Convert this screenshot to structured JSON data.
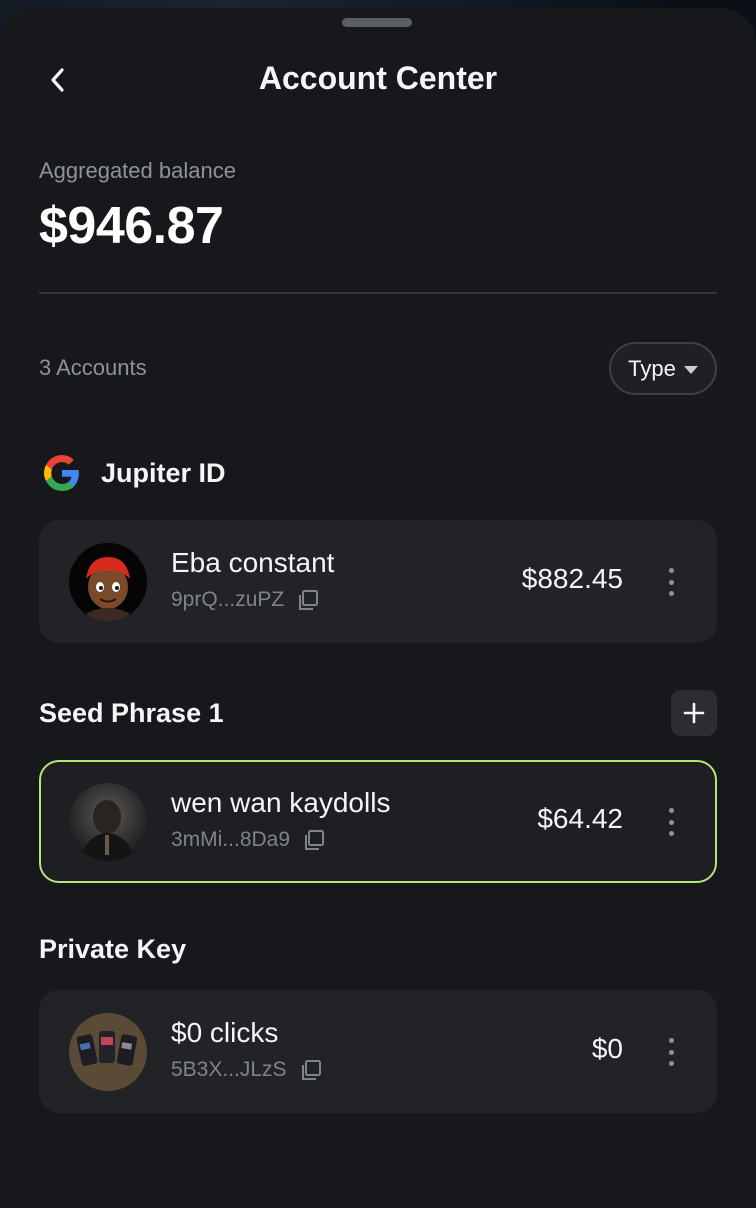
{
  "header": {
    "title": "Account Center",
    "back_icon": "chevron-left-icon"
  },
  "balance": {
    "label": "Aggregated balance",
    "value": "$946.87"
  },
  "accounts_bar": {
    "count_label": "3 Accounts",
    "filter_label": "Type"
  },
  "sections": [
    {
      "title": "Jupiter ID",
      "icon": "google-icon",
      "accounts": [
        {
          "name": "Eba constant",
          "address": "9prQ...zuPZ",
          "value": "$882.45",
          "active": false
        }
      ]
    },
    {
      "title": "Seed Phrase 1",
      "add_icon": "plus-icon",
      "accounts": [
        {
          "name": "wen wan kaydolls",
          "address": "3mMi...8Da9",
          "value": "$64.42",
          "active": true
        }
      ]
    },
    {
      "title": "Private Key",
      "accounts": [
        {
          "name": "$0 clicks",
          "address": "5B3X...JLzS",
          "value": "$0",
          "active": false
        }
      ]
    }
  ],
  "colors": {
    "sheet": "#17181c",
    "card": "#222327",
    "active_border": "#b2e57a",
    "muted_text": "#8e9299"
  }
}
